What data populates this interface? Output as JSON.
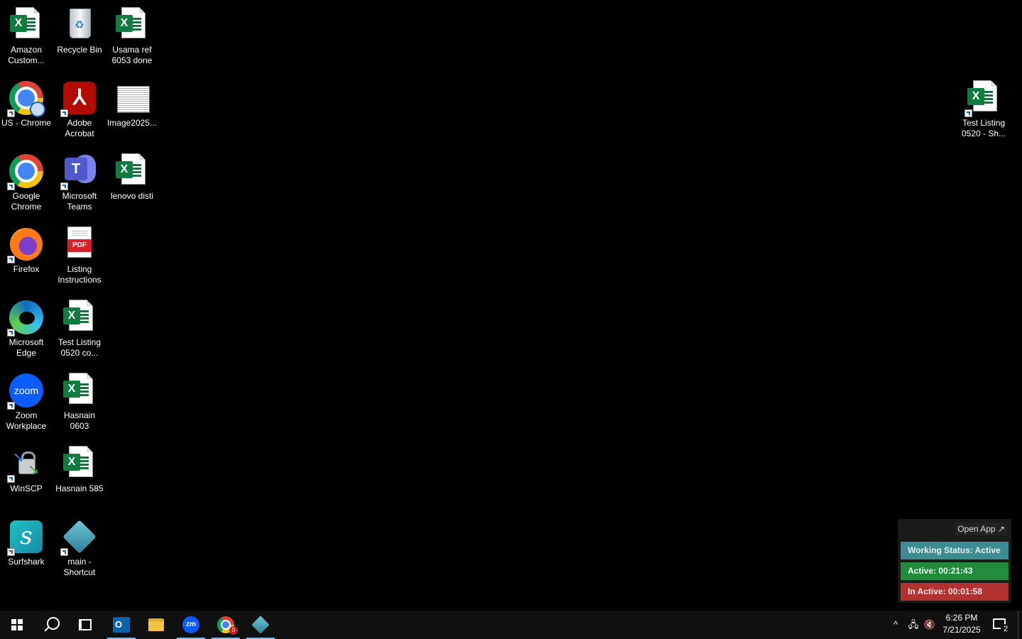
{
  "desktop": {
    "icons": {
      "amazon": "Amazon\nCustom...",
      "recycle": "Recycle Bin",
      "usama": "Usama ref\n6053 done",
      "uschrome": "US - Chrome",
      "acrobat": "Adobe\nAcrobat",
      "image": "Image2025...",
      "chrome": "Google\nChrome",
      "teams": "Microsoft\nTeams",
      "lenovo": "lenovo disti",
      "firefox": "Firefox",
      "listing": "Listing\nInstructions",
      "edge": "Microsoft\nEdge",
      "testco": "Test Listing\n0520 co...",
      "zoom": "Zoom\nWorkplace",
      "hasnain0603": "Hasnain 0603",
      "winscp": "WinSCP",
      "hasnain585": "Hasnain 585",
      "surfshark": "Surfshark",
      "mainshortcut": "main -\nShortcut",
      "testsh": "Test Listing\n0520 - Sh..."
    },
    "glyphs": {
      "excel": "X",
      "pdf": "PDF",
      "teams": "T",
      "zoom": "zoom",
      "surfshark": "s",
      "recycle": "♻"
    }
  },
  "widget": {
    "open_app": "Open App ↗",
    "status": "Working Status: Active",
    "active": "Active: 00:21:43",
    "inactive": "In Active: 00:01:58",
    "colors": {
      "status": "#3d8b93",
      "active": "#228b3c",
      "inactive": "#b1322f"
    }
  },
  "taskbar": {
    "outlook_glyph": "O",
    "zoom_glyph": "zm",
    "chrome_badge": "0",
    "tray": {
      "chevron": "^",
      "network": "🖧",
      "volume": "🔇"
    },
    "time": "6:26 PM",
    "date": "7/21/2025",
    "notifications": "2"
  }
}
